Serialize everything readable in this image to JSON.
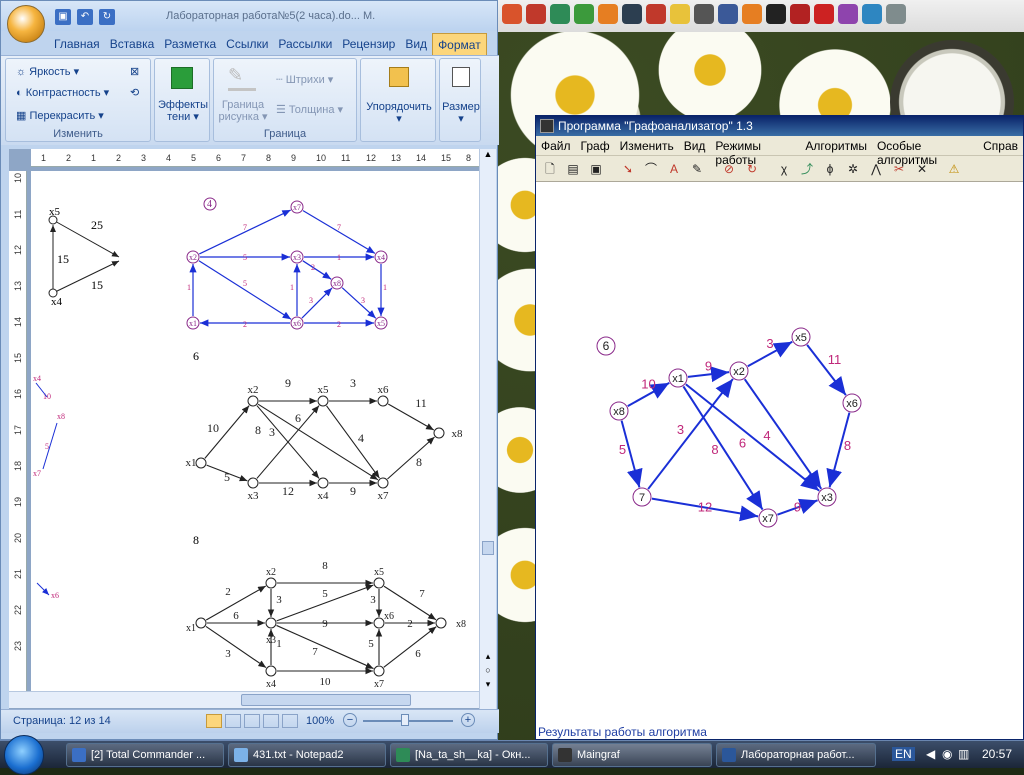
{
  "word": {
    "title": "Лабораторная работа№5(2 часа).do... M.",
    "qat_icons": [
      "save-icon",
      "undo-icon",
      "redo-icon"
    ],
    "tabs": [
      "Главная",
      "Вставка",
      "Разметка",
      "Ссылки",
      "Рассылки",
      "Рецензир",
      "Вид",
      "Формат"
    ],
    "active_tab": "Формат",
    "ribbon": {
      "change": {
        "brightness": "Яркость",
        "contrast": "Контрастность",
        "recolor": "Перекрасить",
        "label": "Изменить"
      },
      "effects": {
        "line1": "Эффекты",
        "line2": "тени"
      },
      "border": {
        "line1": "Граница",
        "line2": "рисунка",
        "dashes": "Штрихи",
        "thickness": "Толщина",
        "label": "Граница"
      },
      "arrange": {
        "label": "Упорядочить"
      },
      "size": {
        "label": "Размер"
      }
    },
    "ruler_h": [
      "1",
      "2",
      "1",
      "2",
      "3",
      "4",
      "5",
      "6",
      "7",
      "8",
      "9",
      "10",
      "11",
      "12",
      "13",
      "14",
      "15",
      "8"
    ],
    "ruler_v": [
      "10",
      "11",
      "12",
      "13",
      "14",
      "15",
      "16",
      "17",
      "18",
      "19",
      "20",
      "21",
      "22",
      "23"
    ],
    "doc": {
      "num4": "4",
      "num6": "6",
      "num8": "8",
      "left_graph_weights": [
        "25",
        "15",
        "15"
      ],
      "left_graph_nodes": [
        "x5",
        "x4"
      ],
      "left_side_labels": [
        "x4",
        "10",
        "x8",
        "5",
        "x7",
        "x6"
      ],
      "graph4": {
        "nodes": [
          "x7",
          "x2",
          "x3",
          "x4",
          "x8",
          "x1",
          "x6",
          "x5"
        ],
        "weights": [
          "7",
          "7",
          "5",
          "1",
          "2",
          "3",
          "1",
          "5",
          "1",
          "3",
          "2",
          "2",
          "1"
        ]
      },
      "graph6": {
        "nodes": [
          "x2",
          "x5",
          "x6",
          "x1",
          "x3",
          "x4",
          "x7",
          "x8"
        ],
        "weights": [
          "9",
          "3",
          "11",
          "10",
          "6",
          "8",
          "4",
          "5",
          "3",
          "8",
          "12",
          "9"
        ]
      },
      "graph8": {
        "nodes": [
          "x2",
          "x5",
          "x1",
          "x3",
          "x6",
          "x8",
          "x4",
          "x7"
        ],
        "weights": [
          "8",
          "2",
          "3",
          "5",
          "7",
          "6",
          "9",
          "2",
          "3",
          "1",
          "7",
          "5",
          "6",
          "10",
          "3"
        ]
      }
    },
    "status": {
      "page": "Страница: 12 из 14",
      "zoom": "100%"
    }
  },
  "graph_app": {
    "title": "Программа \"Графоанализатор\" 1.3",
    "menu": [
      "Файл",
      "Граф",
      "Изменить",
      "Вид",
      "Режимы работы",
      "Алгоритмы",
      "Особые алгоритмы",
      "Справ"
    ],
    "toolbar_icons": [
      "new-icon",
      "open-icon",
      "save-icon",
      "pointer-icon",
      "curve-icon",
      "text-icon",
      "edit-icon",
      "stop-icon",
      "refresh-icon",
      "chi-icon",
      "path-icon",
      "phi-icon",
      "tree-icon",
      "flow-icon",
      "cut-icon",
      "cross-icon",
      "warning-icon"
    ],
    "label": "6",
    "nodes": [
      "x1",
      "x2",
      "x5",
      "x8",
      "x6",
      "7",
      "x7",
      "x3"
    ],
    "weights": [
      "9",
      "3",
      "11",
      "10",
      "5",
      "3",
      "8",
      "6",
      "4",
      "8",
      "12",
      "9"
    ],
    "results": "Результаты работы алгоритма"
  },
  "taskbar": {
    "tasks": [
      "[2] Total Commander ...",
      "431.txt - Notepad2",
      "[Na_ta_sh__ka] - Окн...",
      "Maingraf",
      "Лабораторная работ..."
    ],
    "lang": "EN",
    "time": "20:57"
  },
  "colors": {
    "graph_edge": "#1a2fd6",
    "graph_weight": "#c0287a",
    "node_stroke": "#8a2a8a"
  }
}
